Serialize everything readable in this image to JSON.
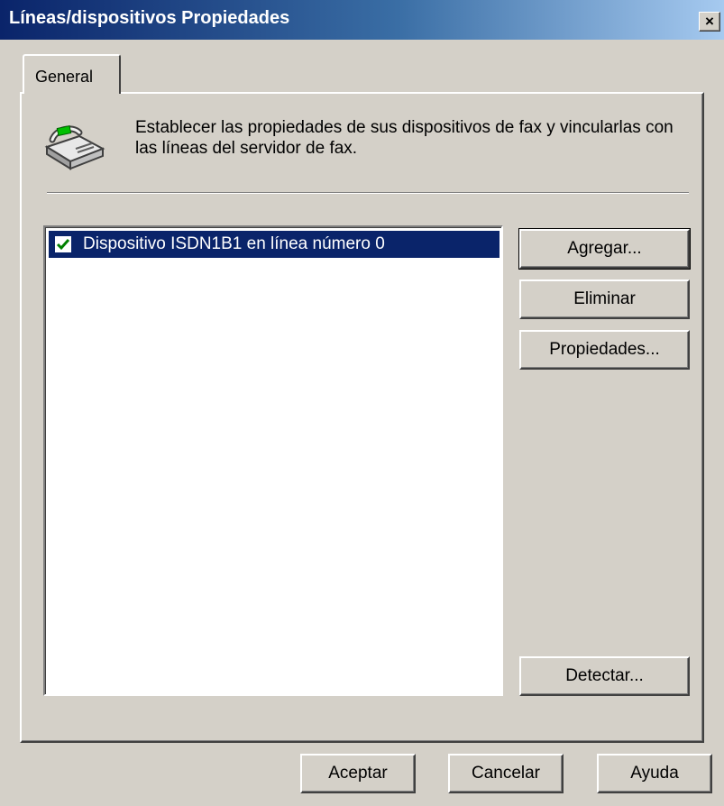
{
  "window": {
    "title": "Líneas/dispositivos Propiedades",
    "close_label": "×"
  },
  "tabs": [
    {
      "label": "General",
      "selected": true
    }
  ],
  "general": {
    "icon": "fax-machine-icon",
    "description": "Establecer las propiedades de sus dispositivos de fax y vincularlas con las líneas del servidor de fax.",
    "devices": [
      {
        "label": "Dispositivo ISDN1B1 en línea número 0",
        "checked": true,
        "selected": true
      }
    ],
    "buttons": {
      "agregar": "Agregar...",
      "eliminar": "Eliminar",
      "propiedades": "Propiedades...",
      "detectar": "Detectar..."
    }
  },
  "footer": {
    "aceptar": "Aceptar",
    "cancelar": "Cancelar",
    "ayuda": "Ayuda"
  },
  "colors": {
    "face": "#d4d0c8",
    "title_start": "#0a246a",
    "title_end": "#a6caf0",
    "selection": "#0a246a"
  }
}
